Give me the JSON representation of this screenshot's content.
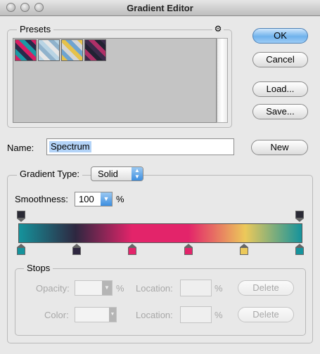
{
  "window": {
    "title": "Gradient Editor"
  },
  "presets": {
    "label": "Presets",
    "menu_icon": "gear-icon",
    "swatches": [
      {
        "name": "stripes-pink-teal",
        "colors": [
          "#d91e63",
          "#1b9aa5",
          "#2a2a4a"
        ]
      },
      {
        "name": "stripes-light-blue",
        "colors": [
          "#b9d4e4",
          "#e6e6e6",
          "#8fb2cc"
        ]
      },
      {
        "name": "stripes-yellow-blue",
        "colors": [
          "#e6c24c",
          "#6fa4d0",
          "#d5d5d5"
        ]
      },
      {
        "name": "stripes-dark-pink",
        "colors": [
          "#3b2a4a",
          "#b03068",
          "#222233"
        ]
      }
    ]
  },
  "buttons": {
    "ok": "OK",
    "cancel": "Cancel",
    "load": "Load...",
    "save": "Save...",
    "new": "New"
  },
  "name": {
    "label": "Name:",
    "value": "Spectrum"
  },
  "gradient": {
    "type_label": "Gradient Type:",
    "type_value": "Solid",
    "smoothness_label": "Smoothness:",
    "smoothness_value": "100",
    "smoothness_unit": "%",
    "color_stops": [
      {
        "color": "#15939c",
        "location_percent": 0
      },
      {
        "color": "#2e2740",
        "location_percent": 20
      },
      {
        "color": "#e3246a",
        "location_percent": 40
      },
      {
        "color": "#e3246a",
        "location_percent": 60
      },
      {
        "color": "#ecc95a",
        "location_percent": 80
      },
      {
        "color": "#15939c",
        "location_percent": 100
      }
    ],
    "opacity_stops": [
      {
        "opacity_percent": 100,
        "location_percent": 0
      },
      {
        "opacity_percent": 100,
        "location_percent": 100
      }
    ]
  },
  "stops": {
    "label": "Stops",
    "opacity_label": "Opacity:",
    "opacity_unit": "%",
    "location_label": "Location:",
    "location_unit": "%",
    "color_label": "Color:",
    "delete_label": "Delete"
  }
}
